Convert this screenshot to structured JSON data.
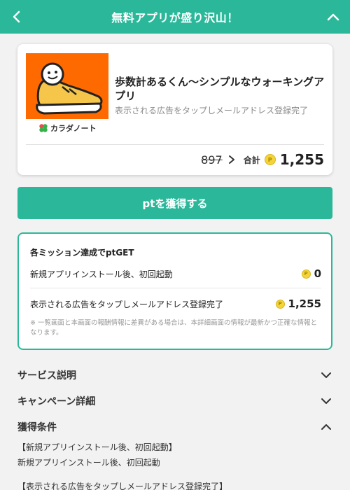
{
  "header": {
    "title": "無料アプリが盛り沢山！",
    "colors": {
      "brand": "#2bb89a",
      "text_on_brand": "#ffffff"
    }
  },
  "offer": {
    "app_title": "歩数計あるくん〜シンプルなウォーキングアプリ",
    "subtitle": "表示される広告をタップしメールアドレス登録完了",
    "brand_name": "カラダノート",
    "old_points": "897",
    "total_label": "合計",
    "total_points": "1,255",
    "coin_glyph": "P",
    "thumb_bg": "#ff6a00"
  },
  "cta": {
    "label": "ptを獲得する"
  },
  "missions": {
    "title": "各ミッション達成でptGET",
    "items": [
      {
        "label": "新規アプリインストール後、初回起動",
        "points": "0"
      },
      {
        "label": "表示される広告をタップしメールアドレス登録完了",
        "points": "1,255"
      }
    ],
    "note": "※ 一覧画面と本画面の報酬情報に差異がある場合は、本詳細画面の情報が最新かつ正確な情報となります。"
  },
  "accordions": [
    {
      "label": "サービス説明",
      "state": "collapsed"
    },
    {
      "label": "キャンペーン詳細",
      "state": "collapsed"
    },
    {
      "label": "獲得条件",
      "state": "expanded"
    }
  ],
  "conditions": {
    "line1": "【新規アプリインストール後、初回起動】",
    "line2": "新規アプリインストール後、初回起動",
    "line3": "【表示される広告をタップしメールアドレス登録完了】"
  }
}
